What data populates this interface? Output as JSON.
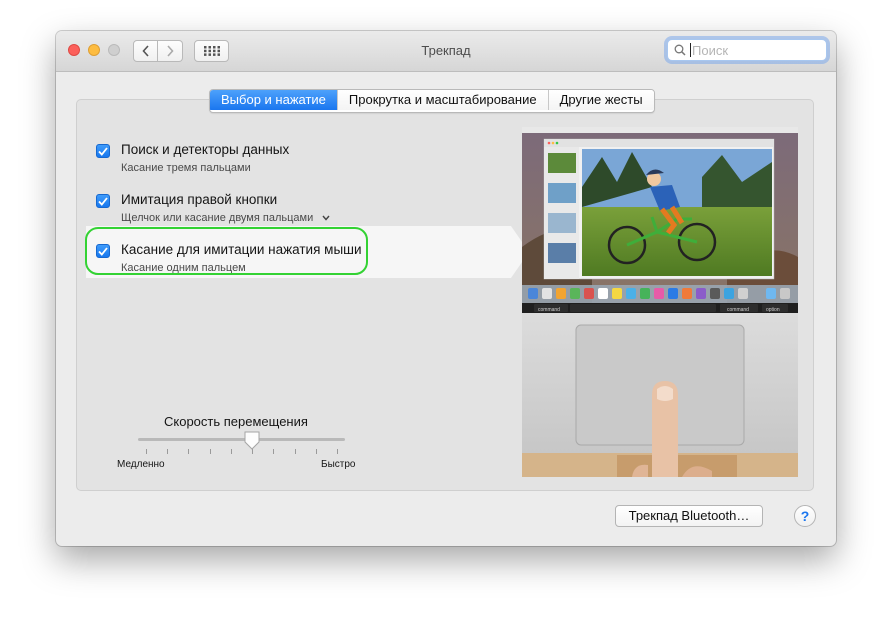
{
  "window": {
    "title": "Трекпад"
  },
  "search": {
    "placeholder": "Поиск"
  },
  "tabs": [
    {
      "label": "Выбор и нажатие",
      "active": true
    },
    {
      "label": "Прокрутка и масштабирование",
      "active": false
    },
    {
      "label": "Другие жесты",
      "active": false
    }
  ],
  "options": [
    {
      "title": "Поиск и детекторы данных",
      "subtitle": "Касание тремя пальцами",
      "checked": true
    },
    {
      "title": "Имитация правой кнопки",
      "subtitle": "Щелчок или касание двумя пальцами",
      "checked": true,
      "has_dropdown": true
    },
    {
      "title": "Касание для имитации нажатия мыши",
      "subtitle": "Касание одним пальцем",
      "checked": true,
      "selected": true
    }
  ],
  "tracking_speed": {
    "label": "Скорость перемещения",
    "min_label": "Медленно",
    "max_label": "Быстро",
    "value_fraction": 0.55,
    "tick_count": 10
  },
  "preview": {
    "keys": [
      "command",
      "command",
      "option"
    ]
  },
  "buttons": {
    "bluetooth": "Трекпад Bluetooth…",
    "help": "?"
  },
  "colors": {
    "accent": "#1a76ef",
    "highlight_ring": "#33d233"
  }
}
